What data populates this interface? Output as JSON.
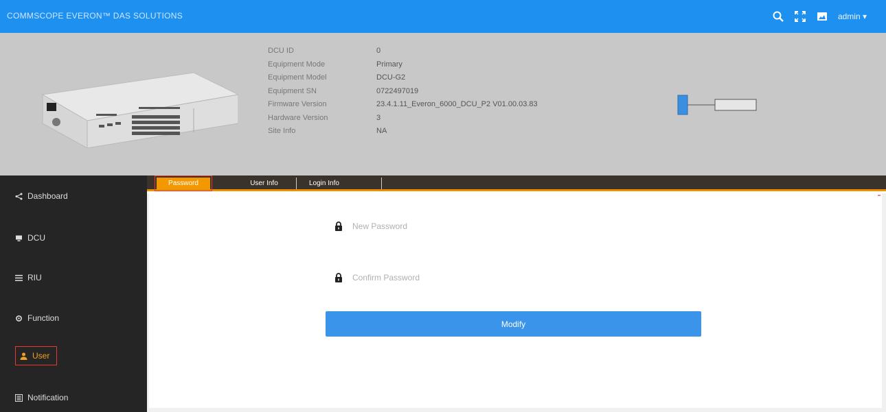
{
  "app": {
    "brand": "COMMSCOPE EVERON™ DAS SOLUTIONS",
    "user_menu_label": "admin",
    "accent_color": "#1e90f0"
  },
  "device": {
    "rows": [
      {
        "label": "DCU ID",
        "value": "0"
      },
      {
        "label": "Equipment Mode",
        "value": "Primary"
      },
      {
        "label": "Equipment Model",
        "value": "DCU-G2"
      },
      {
        "label": "Equipment SN",
        "value": "0722497019"
      },
      {
        "label": "Firmware Version",
        "value": "23.4.1.11_Everon_6000_DCU_P2 V01.00.03.83"
      },
      {
        "label": "Hardware Version",
        "value": "3"
      },
      {
        "label": "Site Info",
        "value": "NA"
      }
    ]
  },
  "sidebar": {
    "items": [
      {
        "label": "Dashboard",
        "icon": "share-icon"
      },
      {
        "label": "DCU",
        "icon": "monitor-icon"
      },
      {
        "label": "RIU",
        "icon": "list-icon"
      },
      {
        "label": "Function",
        "icon": "gear-icon"
      },
      {
        "label": "User",
        "icon": "user-icon",
        "active": true
      },
      {
        "label": "Notification",
        "icon": "notification-icon"
      }
    ]
  },
  "tabs": [
    {
      "label": "Password",
      "active": true
    },
    {
      "label": "User Info"
    },
    {
      "label": "Login Info"
    }
  ],
  "form": {
    "new_password": {
      "placeholder": "New Password",
      "value": ""
    },
    "confirm_password": {
      "placeholder": "Confirm Password",
      "value": ""
    },
    "modify_label": "Modify"
  }
}
